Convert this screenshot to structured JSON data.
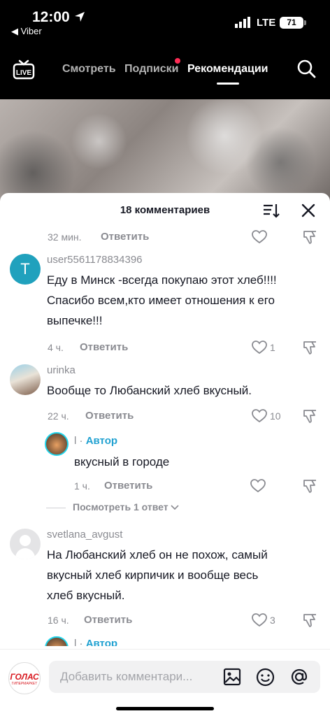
{
  "status_bar": {
    "time": "12:00",
    "back_app": "◀ Viber",
    "network": "LTE",
    "battery": "71"
  },
  "top_nav": {
    "tabs": [
      {
        "label": "Смотреть",
        "active": false
      },
      {
        "label": "Подписки",
        "active": false,
        "has_notification_dot": true
      },
      {
        "label": "Рекомендации",
        "active": true
      }
    ]
  },
  "comments_sheet": {
    "title": "18 комментариев",
    "comments": [
      {
        "time": "32 мин.",
        "reply_label": "Ответить",
        "likes": ""
      },
      {
        "avatar_letter": "T",
        "username": "user5561178834396",
        "text_lines": [
          "Еду в Минск -всегда покупаю этот хлеб!!!!",
          "Спасибо всем,кто имеет отношения к его",
          "выпечке!!!"
        ],
        "time": "4 ч.",
        "reply_label": "Ответить",
        "likes": "1"
      },
      {
        "username": "urinka",
        "text_lines": [
          "Вообще то Любанский хлеб вкусный."
        ],
        "time": "22 ч.",
        "reply_label": "Ответить",
        "likes": "10",
        "reply": {
          "author_name": "l",
          "author_badge": "Автор",
          "text": "вкусный в городе",
          "time": "1 ч.",
          "reply_label": "Ответить",
          "likes": ""
        },
        "view_replies": "Посмотреть 1 ответ"
      },
      {
        "username": "svetlana_avgust",
        "text_lines": [
          "На Любанский хлеб он не похож, самый",
          "вкусный хлеб кирпичик и вообще весь",
          "хлеб вкусный."
        ],
        "time": "16 ч.",
        "reply_label": "Ответить",
        "likes": "3",
        "reply_peek": {
          "author_name": "l",
          "author_badge": "Автор"
        }
      }
    ]
  },
  "input_bar": {
    "placeholder": "Добавить комментари...",
    "my_avatar_brand": "ГОЛАС",
    "my_avatar_sub": "ГИПЕРМАРКЕТ"
  },
  "colors": {
    "accent_red": "#fe2c55",
    "author_blue": "#20a1d1",
    "muted_text": "#8a8b91"
  }
}
